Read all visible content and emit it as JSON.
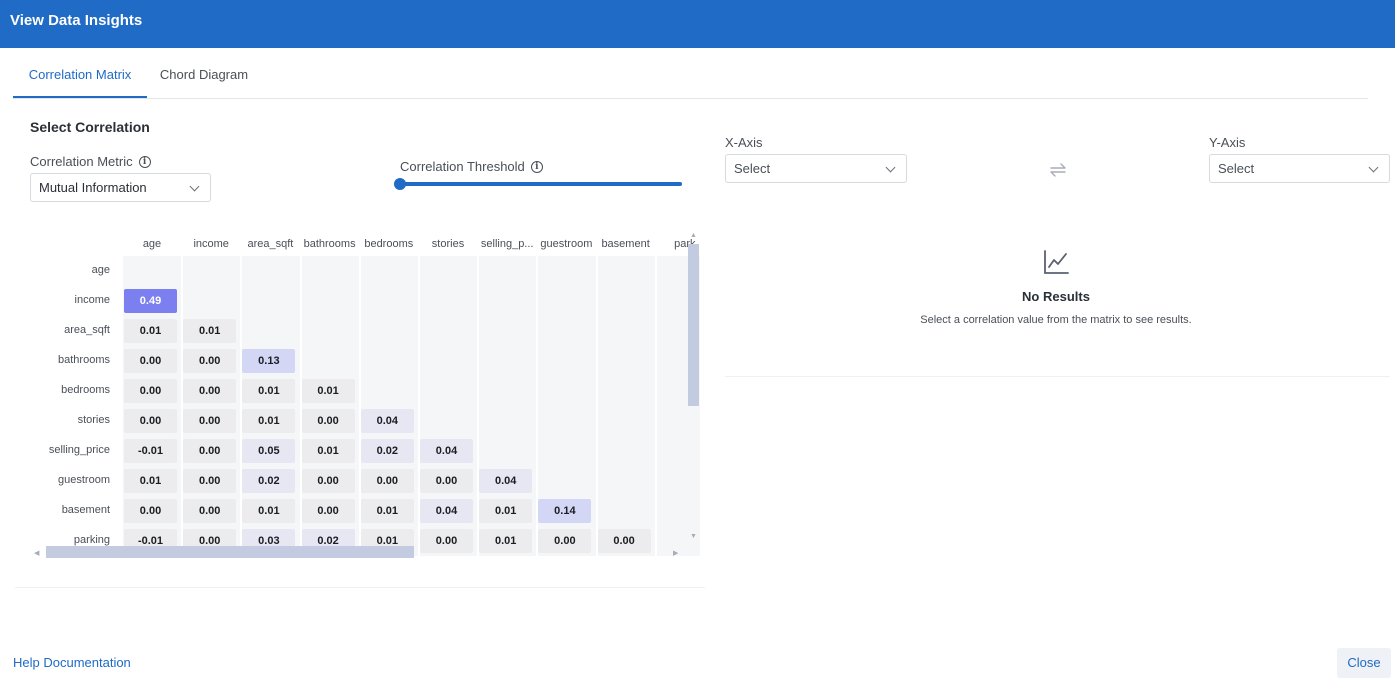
{
  "window": {
    "title": "View Data Insights"
  },
  "tabs": [
    {
      "label": "Correlation Matrix",
      "active": true
    },
    {
      "label": "Chord Diagram",
      "active": false
    }
  ],
  "controls": {
    "section_title": "Select Correlation",
    "metric_label": "Correlation Metric",
    "metric_value": "Mutual Information",
    "threshold_label": "Correlation Threshold",
    "threshold_value": 0,
    "x_axis_label": "X-Axis",
    "x_axis_value": "Select",
    "y_axis_label": "Y-Axis",
    "y_axis_value": "Select"
  },
  "matrix": {
    "columns": [
      "age",
      "income",
      "area_sqft",
      "bathrooms",
      "bedrooms",
      "stories",
      "selling_p...",
      "guestroom",
      "basement",
      "park"
    ],
    "rows": [
      "age",
      "income",
      "area_sqft",
      "bathrooms",
      "bedrooms",
      "stories",
      "selling_price",
      "guestroom",
      "basement",
      "parking"
    ],
    "values": [
      [],
      [
        "0.49"
      ],
      [
        "0.01",
        "0.01"
      ],
      [
        "0.00",
        "0.00",
        "0.13"
      ],
      [
        "0.00",
        "0.00",
        "0.01",
        "0.01"
      ],
      [
        "0.00",
        "0.00",
        "0.01",
        "0.00",
        "0.04"
      ],
      [
        "-0.01",
        "0.00",
        "0.05",
        "0.01",
        "0.02",
        "0.04"
      ],
      [
        "0.01",
        "0.00",
        "0.02",
        "0.00",
        "0.00",
        "0.00",
        "0.04"
      ],
      [
        "0.00",
        "0.00",
        "0.01",
        "0.00",
        "0.01",
        "0.04",
        "0.01",
        "0.14"
      ],
      [
        "-0.01",
        "0.00",
        "0.03",
        "0.02",
        "0.01",
        "0.00",
        "0.01",
        "0.00",
        "0.00"
      ]
    ],
    "colors": {
      "strong": "#7b7ff0",
      "medium": "#d4d6f5",
      "light": "#e6e7f3",
      "base": "#ececee"
    }
  },
  "results": {
    "icon": "line-chart-icon",
    "title": "No Results",
    "message": "Select a correlation value from the matrix to see results."
  },
  "footer": {
    "help_label": "Help Documentation",
    "close_label": "Close"
  }
}
